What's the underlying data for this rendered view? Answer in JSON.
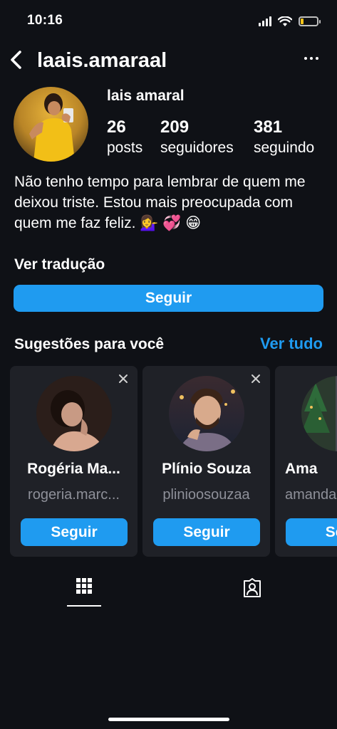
{
  "status_bar": {
    "time": "10:16",
    "battery_level": 0.2,
    "battery_color": "#f5c518"
  },
  "header": {
    "username": "laais.amaraal",
    "back_icon": "chevron-left-icon",
    "more_icon": "more-horizontal-icon"
  },
  "profile": {
    "name": "lais amaral",
    "stats": [
      {
        "value": "26",
        "label": "posts"
      },
      {
        "value": "209",
        "label": "seguidores"
      },
      {
        "value": "381",
        "label": "seguindo"
      }
    ],
    "bio": "Não tenho tempo para lembrar de quem me deixou triste. Estou mais preocupada com quem me faz feliz. 💁‍♀️ 💞 😁",
    "translate_label": "Ver tradução",
    "follow_label": "Seguir"
  },
  "suggestions": {
    "title": "Sugestões para você",
    "see_all": "Ver tudo",
    "cards": [
      {
        "name": "Rogéria Ma...",
        "handle": "rogeria.marc...",
        "follow": "Seguir"
      },
      {
        "name": "Plínio Souza",
        "handle": "plinioosouzaa",
        "follow": "Seguir"
      },
      {
        "name": "Ama",
        "handle": "amanda",
        "follow": "Seg"
      }
    ]
  },
  "tabs": {
    "active": "grid",
    "items": [
      "grid-icon",
      "tagged-person-icon"
    ]
  },
  "colors": {
    "background": "#0f1116",
    "accent": "#1f9bf0",
    "card": "#1f2127",
    "muted_text": "#8e9099"
  }
}
